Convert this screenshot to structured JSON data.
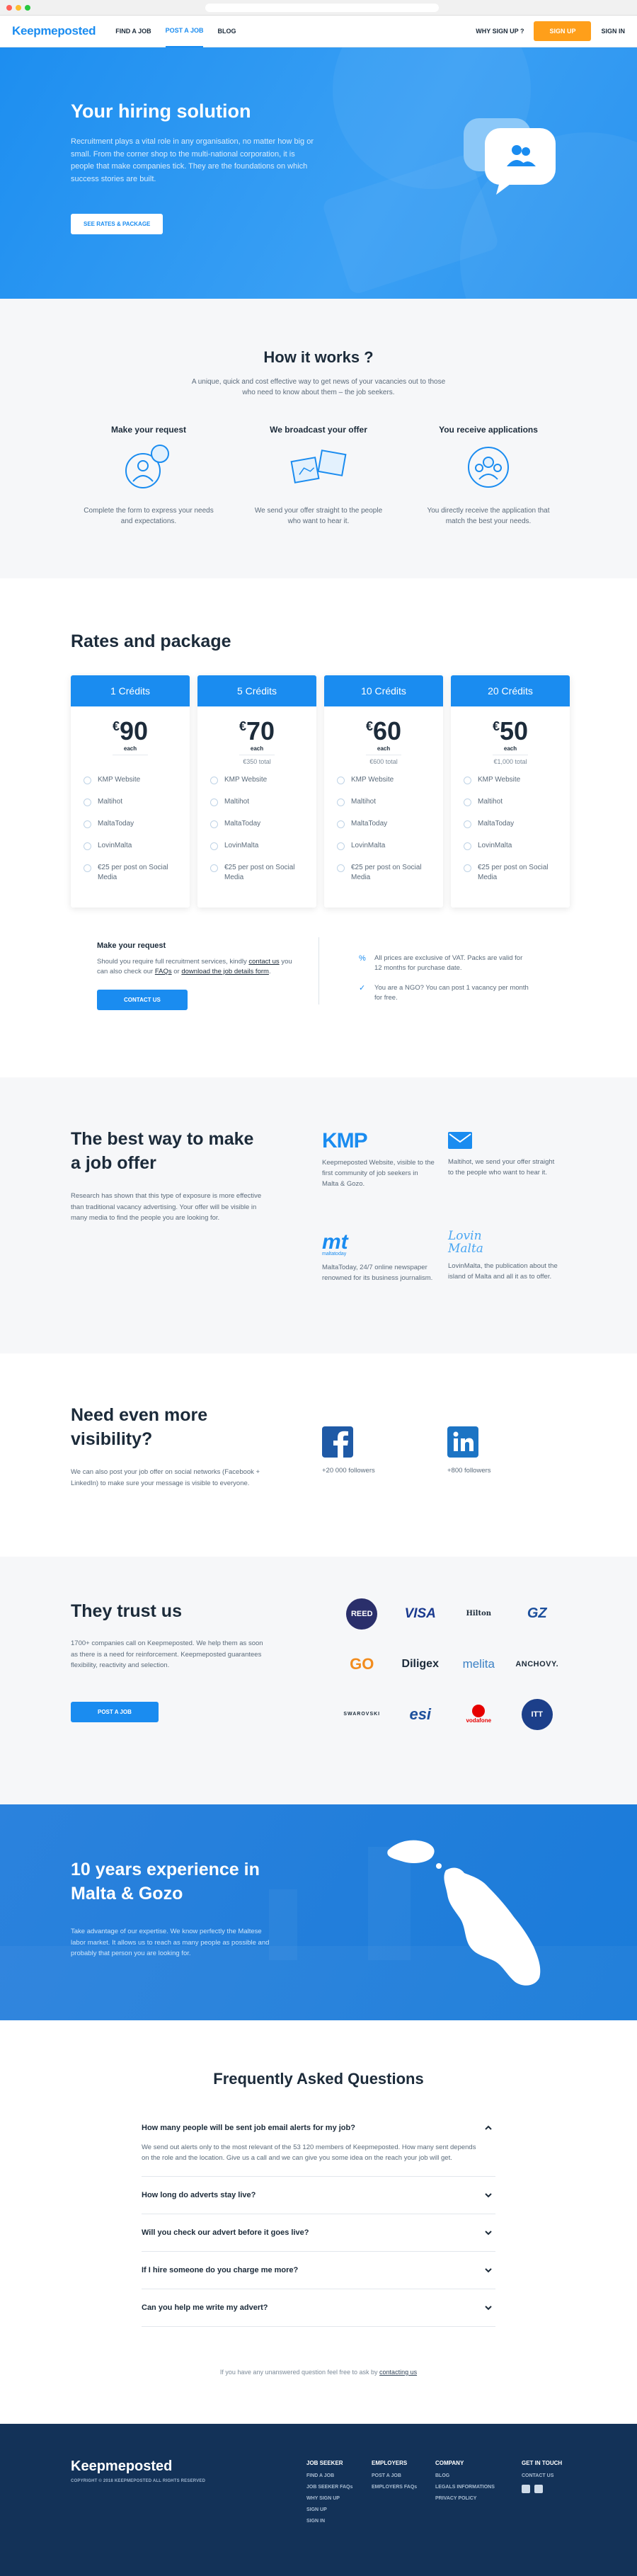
{
  "nav": {
    "logo": "Keepmeposted",
    "links": [
      "FIND A JOB",
      "POST A JOB",
      "BLOG"
    ],
    "why": "WHY SIGN UP ?",
    "signup": "SIGN UP",
    "signin": "SIGN IN"
  },
  "hero": {
    "title": "Your hiring solution",
    "text": "Recruitment plays a vital role in any organisation, no matter how big or small. From the corner shop to the multi-national corporation, it is people that make companies tick. They are the foundations on which success stories are built.",
    "button": "SEE RATES & PACKAGE"
  },
  "how": {
    "title": "How it works ?",
    "subtitle": "A unique, quick and cost effective way to get news of your vacancies out to those who need to know about them – the job seekers.",
    "steps": [
      {
        "title": "Make your request",
        "text": "Complete the form to express your needs and expectations."
      },
      {
        "title": "We broadcast your offer",
        "text": "We send your offer straight to the people who want to hear it."
      },
      {
        "title": "You receive applications",
        "text": "You directly receive the application that match the best your needs."
      }
    ]
  },
  "rates": {
    "title": "Rates and package",
    "cards": [
      {
        "name": "1 Crédits",
        "currency": "€",
        "price": "90",
        "each": "each",
        "total": ""
      },
      {
        "name": "5 Crédits",
        "currency": "€",
        "price": "70",
        "each": "each",
        "total": "€350 total"
      },
      {
        "name": "10 Crédits",
        "currency": "€",
        "price": "60",
        "each": "each",
        "total": "€600 total"
      },
      {
        "name": "20 Crédits",
        "currency": "€",
        "price": "50",
        "each": "each",
        "total": "€1,000 total"
      }
    ],
    "features": [
      "KMP Website",
      "Maltihot",
      "MaltaToday",
      "LovinMalta",
      "€25 per post on Social Media"
    ],
    "request": {
      "title": "Make your request",
      "text_a": "Should you require full recruitment services, kindly ",
      "link1": "contact us",
      "text_b": " you can also check our ",
      "link2": "FAQs",
      "text_c": " or ",
      "link3": "download the job details form",
      "text_d": ".",
      "button": "CONTACT US"
    },
    "notes": [
      "All prices are exclusive of VAT. Packs are valid for 12 months for purchase date.",
      "You are a NGO? You can post 1 vacancy per month for free."
    ]
  },
  "best": {
    "title": "The best way to make a job offer",
    "text": "Research has shown that this type of exposure is more effective than traditional vacancy advertising. Your offer will be visible in many media to find the people you are looking for.",
    "media": [
      {
        "logo": "KMP",
        "text": "Keepmeposted Website, visible to the first community of job seekers in Malta & Gozo."
      },
      {
        "text": "Maltihot, we send your offer straight to the people who want to hear it."
      },
      {
        "logo": "mt",
        "sub": "maltatoday",
        "text": "MaltaToday, 24/7 online newspaper renowned for its business journalism."
      },
      {
        "logo": "Lovin Malta",
        "text": "LovinMalta, the publication about the island of Malta and all it as to offer."
      }
    ]
  },
  "visibility": {
    "title": "Need even more visibility?",
    "text": "We can also post your job offer on social networks (Facebook + LinkedIn) to make sure your message is visible to everyone.",
    "facebook": "+20 000 followers",
    "linkedin": "+800 followers"
  },
  "trust": {
    "title": "They trust us",
    "text": "1700+ companies call on Keepmeposted. We help them as soon as there is a need for reinforcement. Keepmeposted guarantees flexibility, reactivity and selection.",
    "button": "POST A JOB",
    "logos": [
      "REED",
      "VISA",
      "Hilton",
      "GZ",
      "GO",
      "Diligex",
      "melita",
      "ANCHOVY.",
      "SWAROVSKI",
      "esi",
      "vodafone",
      "ITT"
    ]
  },
  "experience": {
    "title": "10 years experience in Malta & Gozo",
    "text": "Take advantage of our expertise. We know perfectly the Maltese labor market. It allows us to reach as many people as possible and probably that person you are looking for."
  },
  "faq": {
    "title": "Frequently Asked Questions",
    "items": [
      {
        "q": "How many people will be sent job email alerts for my job?",
        "a": "We send out alerts only to the most relevant of the 53 120 members of Keepmeposted. How many sent depends on the role and the location. Give us a call and we can give you some idea on the reach your job will get."
      },
      {
        "q": "How long do adverts stay live?"
      },
      {
        "q": "Will you check our advert before it goes live?"
      },
      {
        "q": "If I hire someone do you charge me more?"
      },
      {
        "q": "Can you help me write my advert?"
      }
    ],
    "note": "If you have any unanswered question feel free to ask by ",
    "note_link": "contacting us"
  },
  "footer": {
    "logo": "Keepmeposted",
    "copy": "COPYRIGHT © 2018 KEEPMEPOSTED ALL RIGHTS RESERVED",
    "cols": [
      {
        "title": "JOB SEEKER",
        "links": [
          "FIND A JOB",
          "JOB SEEKER FAQs",
          "WHY SIGN UP",
          "SIGN UP",
          "SIGN IN"
        ]
      },
      {
        "title": "EMPLOYERS",
        "links": [
          "POST A JOB",
          "EMPLOYERS FAQs"
        ]
      },
      {
        "title": "COMPANY",
        "links": [
          "BLOG",
          "LEGALS INFORMATIONS",
          "PRIVACY POLICY"
        ]
      },
      {
        "title": "GET IN TOUCH",
        "links": [
          "CONTACT US"
        ]
      }
    ]
  },
  "colors": {
    "brand": "#1a8cf0",
    "accent": "#ff9f1a",
    "footer": "#133258"
  }
}
